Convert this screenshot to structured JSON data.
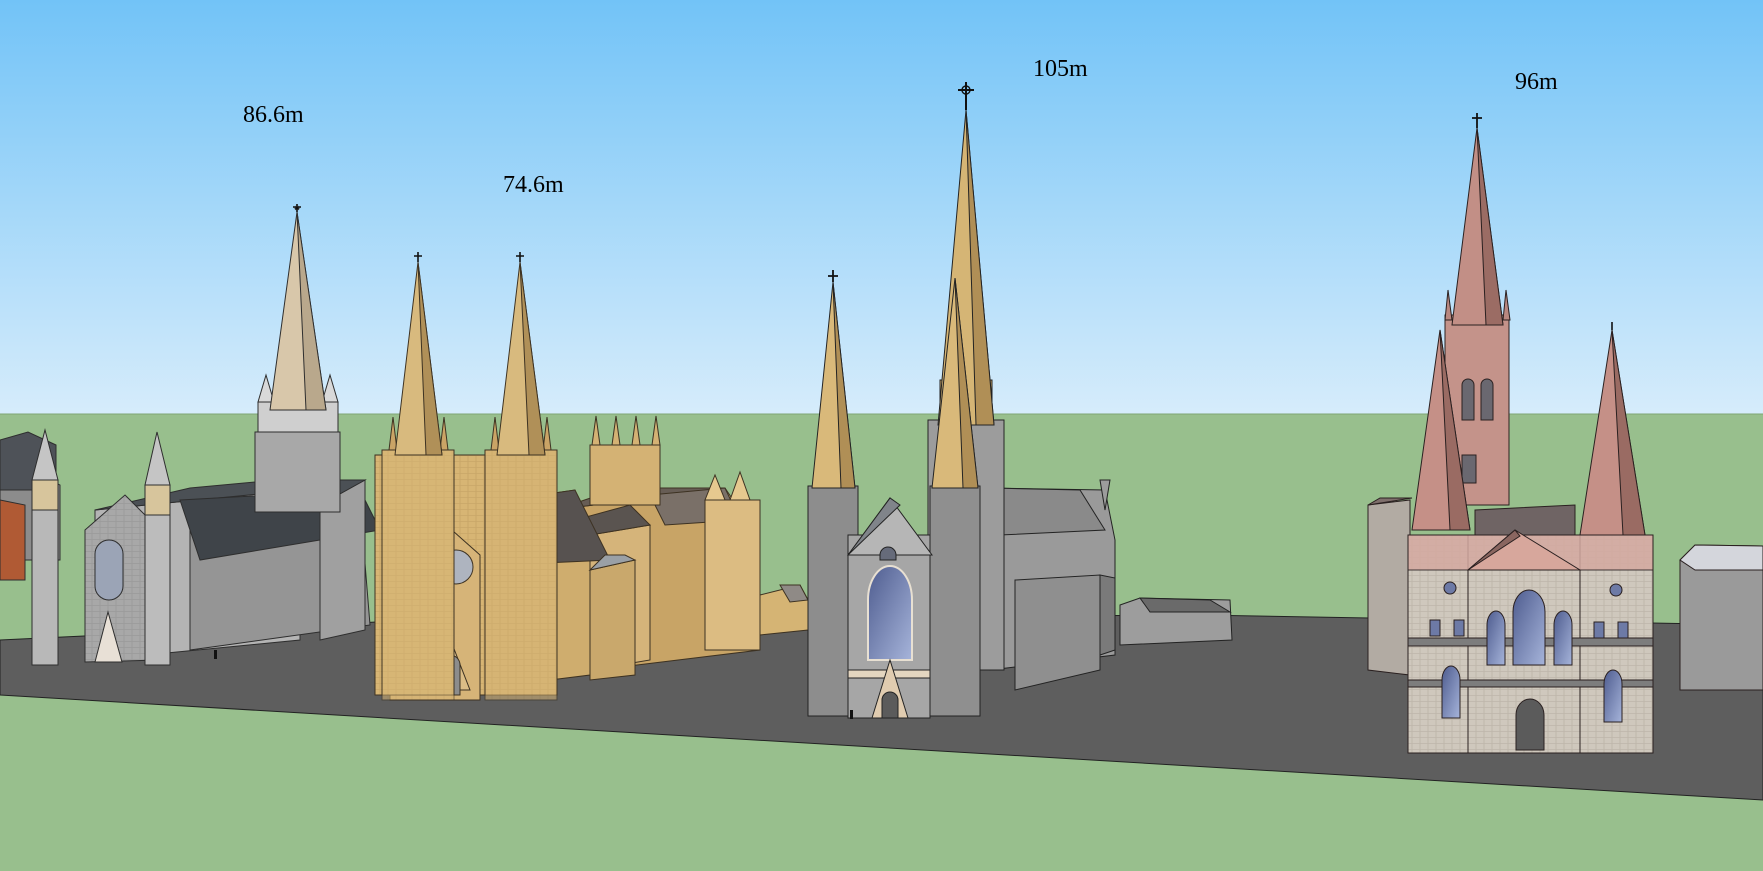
{
  "scene": {
    "colors": {
      "sky_top": "#72c3f7",
      "sky_bottom": "#d6ecfb",
      "ground": "#98bf8d",
      "road": "#5e5e5e",
      "grey_stone": "#a4a4a4",
      "sandstone": "#d9b675",
      "rose_stone": "#c7958a",
      "roof_dark": "#55595e"
    },
    "buildings": [
      {
        "name": "grey-cathedral-left",
        "height_label": "86.6m"
      },
      {
        "name": "sandstone-cathedral",
        "height_label": "74.6m"
      },
      {
        "name": "grey-cathedral-center",
        "height_label": "105m"
      },
      {
        "name": "rose-cathedral-right",
        "height_label": "96m"
      }
    ]
  }
}
